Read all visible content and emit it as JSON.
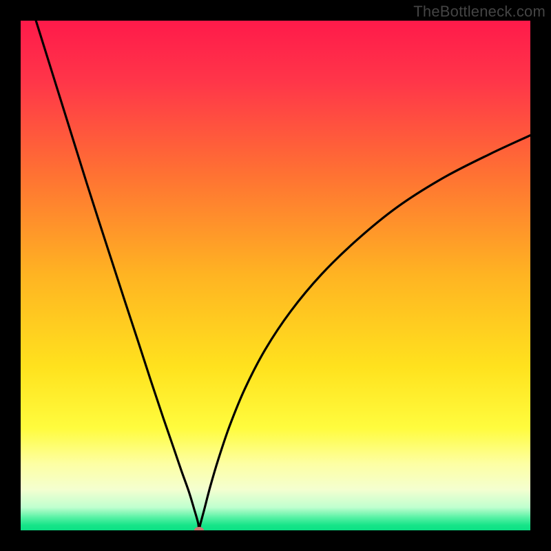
{
  "watermark": "TheBottleneck.com",
  "chart_data": {
    "type": "line",
    "title": "",
    "xlabel": "",
    "ylabel": "",
    "xlim": [
      0,
      100
    ],
    "ylim": [
      0,
      100
    ],
    "grid": false,
    "legend": false,
    "gradient_stops": [
      {
        "offset": 0.0,
        "color": "#ff1a4a"
      },
      {
        "offset": 0.12,
        "color": "#ff3649"
      },
      {
        "offset": 0.3,
        "color": "#ff7133"
      },
      {
        "offset": 0.5,
        "color": "#ffb422"
      },
      {
        "offset": 0.68,
        "color": "#ffe21e"
      },
      {
        "offset": 0.8,
        "color": "#fffc3e"
      },
      {
        "offset": 0.87,
        "color": "#fdffa4"
      },
      {
        "offset": 0.92,
        "color": "#f4ffd0"
      },
      {
        "offset": 0.955,
        "color": "#bfffcf"
      },
      {
        "offset": 0.975,
        "color": "#56f1a4"
      },
      {
        "offset": 0.99,
        "color": "#16e588"
      },
      {
        "offset": 1.0,
        "color": "#0ce085"
      }
    ],
    "minimum_marker": {
      "x": 35.0,
      "y": 0.0,
      "color": "#c97a72"
    },
    "series": [
      {
        "name": "bottleneck-curve",
        "color": "#000000",
        "x": [
          3.0,
          5.5,
          8.0,
          10.5,
          13.0,
          15.5,
          18.0,
          20.5,
          23.0,
          25.5,
          28.0,
          30.0,
          31.5,
          33.0,
          34.0,
          34.8,
          35.0,
          35.2,
          36.0,
          37.2,
          38.8,
          41.0,
          44.0,
          48.0,
          53.0,
          59.0,
          66.0,
          74.0,
          83.0,
          92.0,
          100.0
        ],
        "y": [
          100.0,
          92.0,
          84.0,
          76.0,
          68.0,
          60.2,
          52.5,
          44.8,
          37.2,
          29.5,
          22.0,
          16.2,
          11.8,
          7.6,
          4.3,
          1.5,
          0.0,
          1.0,
          4.0,
          8.6,
          14.0,
          20.5,
          27.8,
          35.5,
          43.0,
          50.2,
          57.0,
          63.5,
          69.2,
          73.8,
          77.5
        ]
      }
    ]
  }
}
